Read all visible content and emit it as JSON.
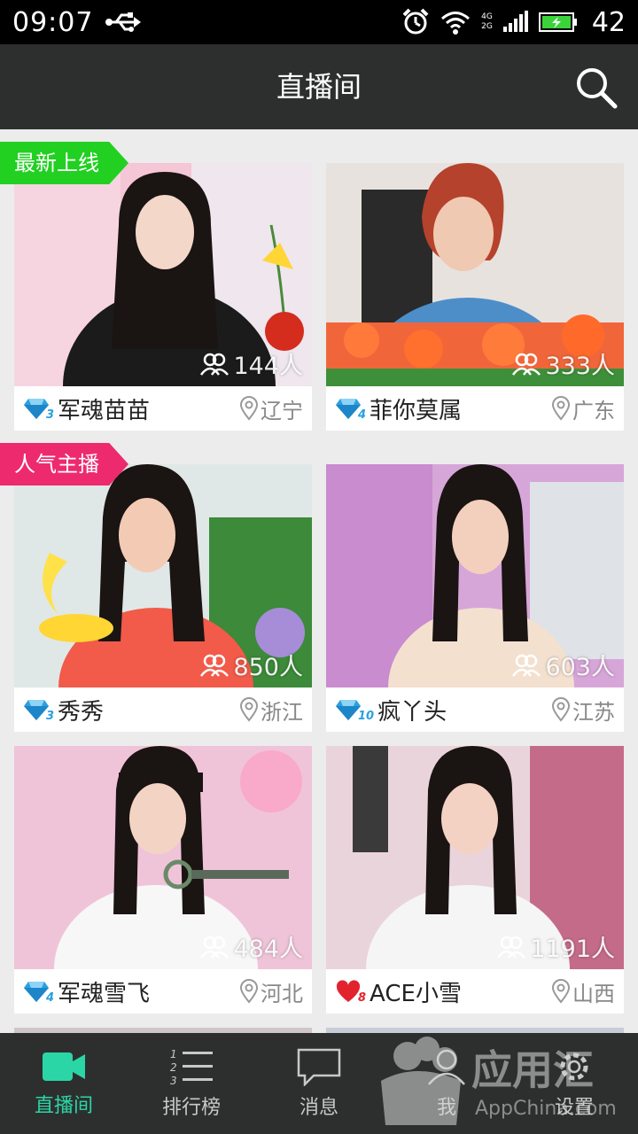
{
  "status_bar": {
    "time": "09:07",
    "network_1": "4G",
    "network_2": "2G",
    "battery": "42"
  },
  "app_bar": {
    "title": "直播间"
  },
  "sections": [
    {
      "label": "最新上线",
      "color": "#21d021"
    },
    {
      "label": "人气主播",
      "color": "#ee2a6e"
    }
  ],
  "hosts": [
    {
      "name": "军魂苗苗",
      "viewers": "144人",
      "location": "辽宁",
      "badge": "diamond",
      "level": "3"
    },
    {
      "name": "菲你莫属",
      "viewers": "333人",
      "location": "广东",
      "badge": "diamond",
      "level": "4"
    },
    {
      "name": "秀秀",
      "viewers": "850人",
      "location": "浙江",
      "badge": "diamond",
      "level": "3"
    },
    {
      "name": "疯丫头",
      "viewers": "603人",
      "location": "江苏",
      "badge": "diamond",
      "level": "10"
    },
    {
      "name": "军魂雪飞",
      "viewers": "484人",
      "location": "河北",
      "badge": "diamond",
      "level": "4"
    },
    {
      "name": "ACE小雪",
      "viewers": "1191人",
      "location": "山西",
      "badge": "heart",
      "level": "8"
    }
  ],
  "tabs": [
    {
      "label": "直播间",
      "icon": "video-camera-icon",
      "active": true
    },
    {
      "label": "排行榜",
      "icon": "ranking-list-icon",
      "active": false
    },
    {
      "label": "消息",
      "icon": "message-icon",
      "active": false
    },
    {
      "label": "我",
      "icon": "user-icon",
      "active": false
    },
    {
      "label": "设置",
      "icon": "gear-icon",
      "active": false
    }
  ],
  "watermark": {
    "title": "应用汇",
    "url": "AppChina.com"
  },
  "colors": {
    "accent": "#2bd6a6",
    "app_bar": "#2d2f2f",
    "diamond": "#2aa0e0",
    "heart": "#e2232e"
  }
}
